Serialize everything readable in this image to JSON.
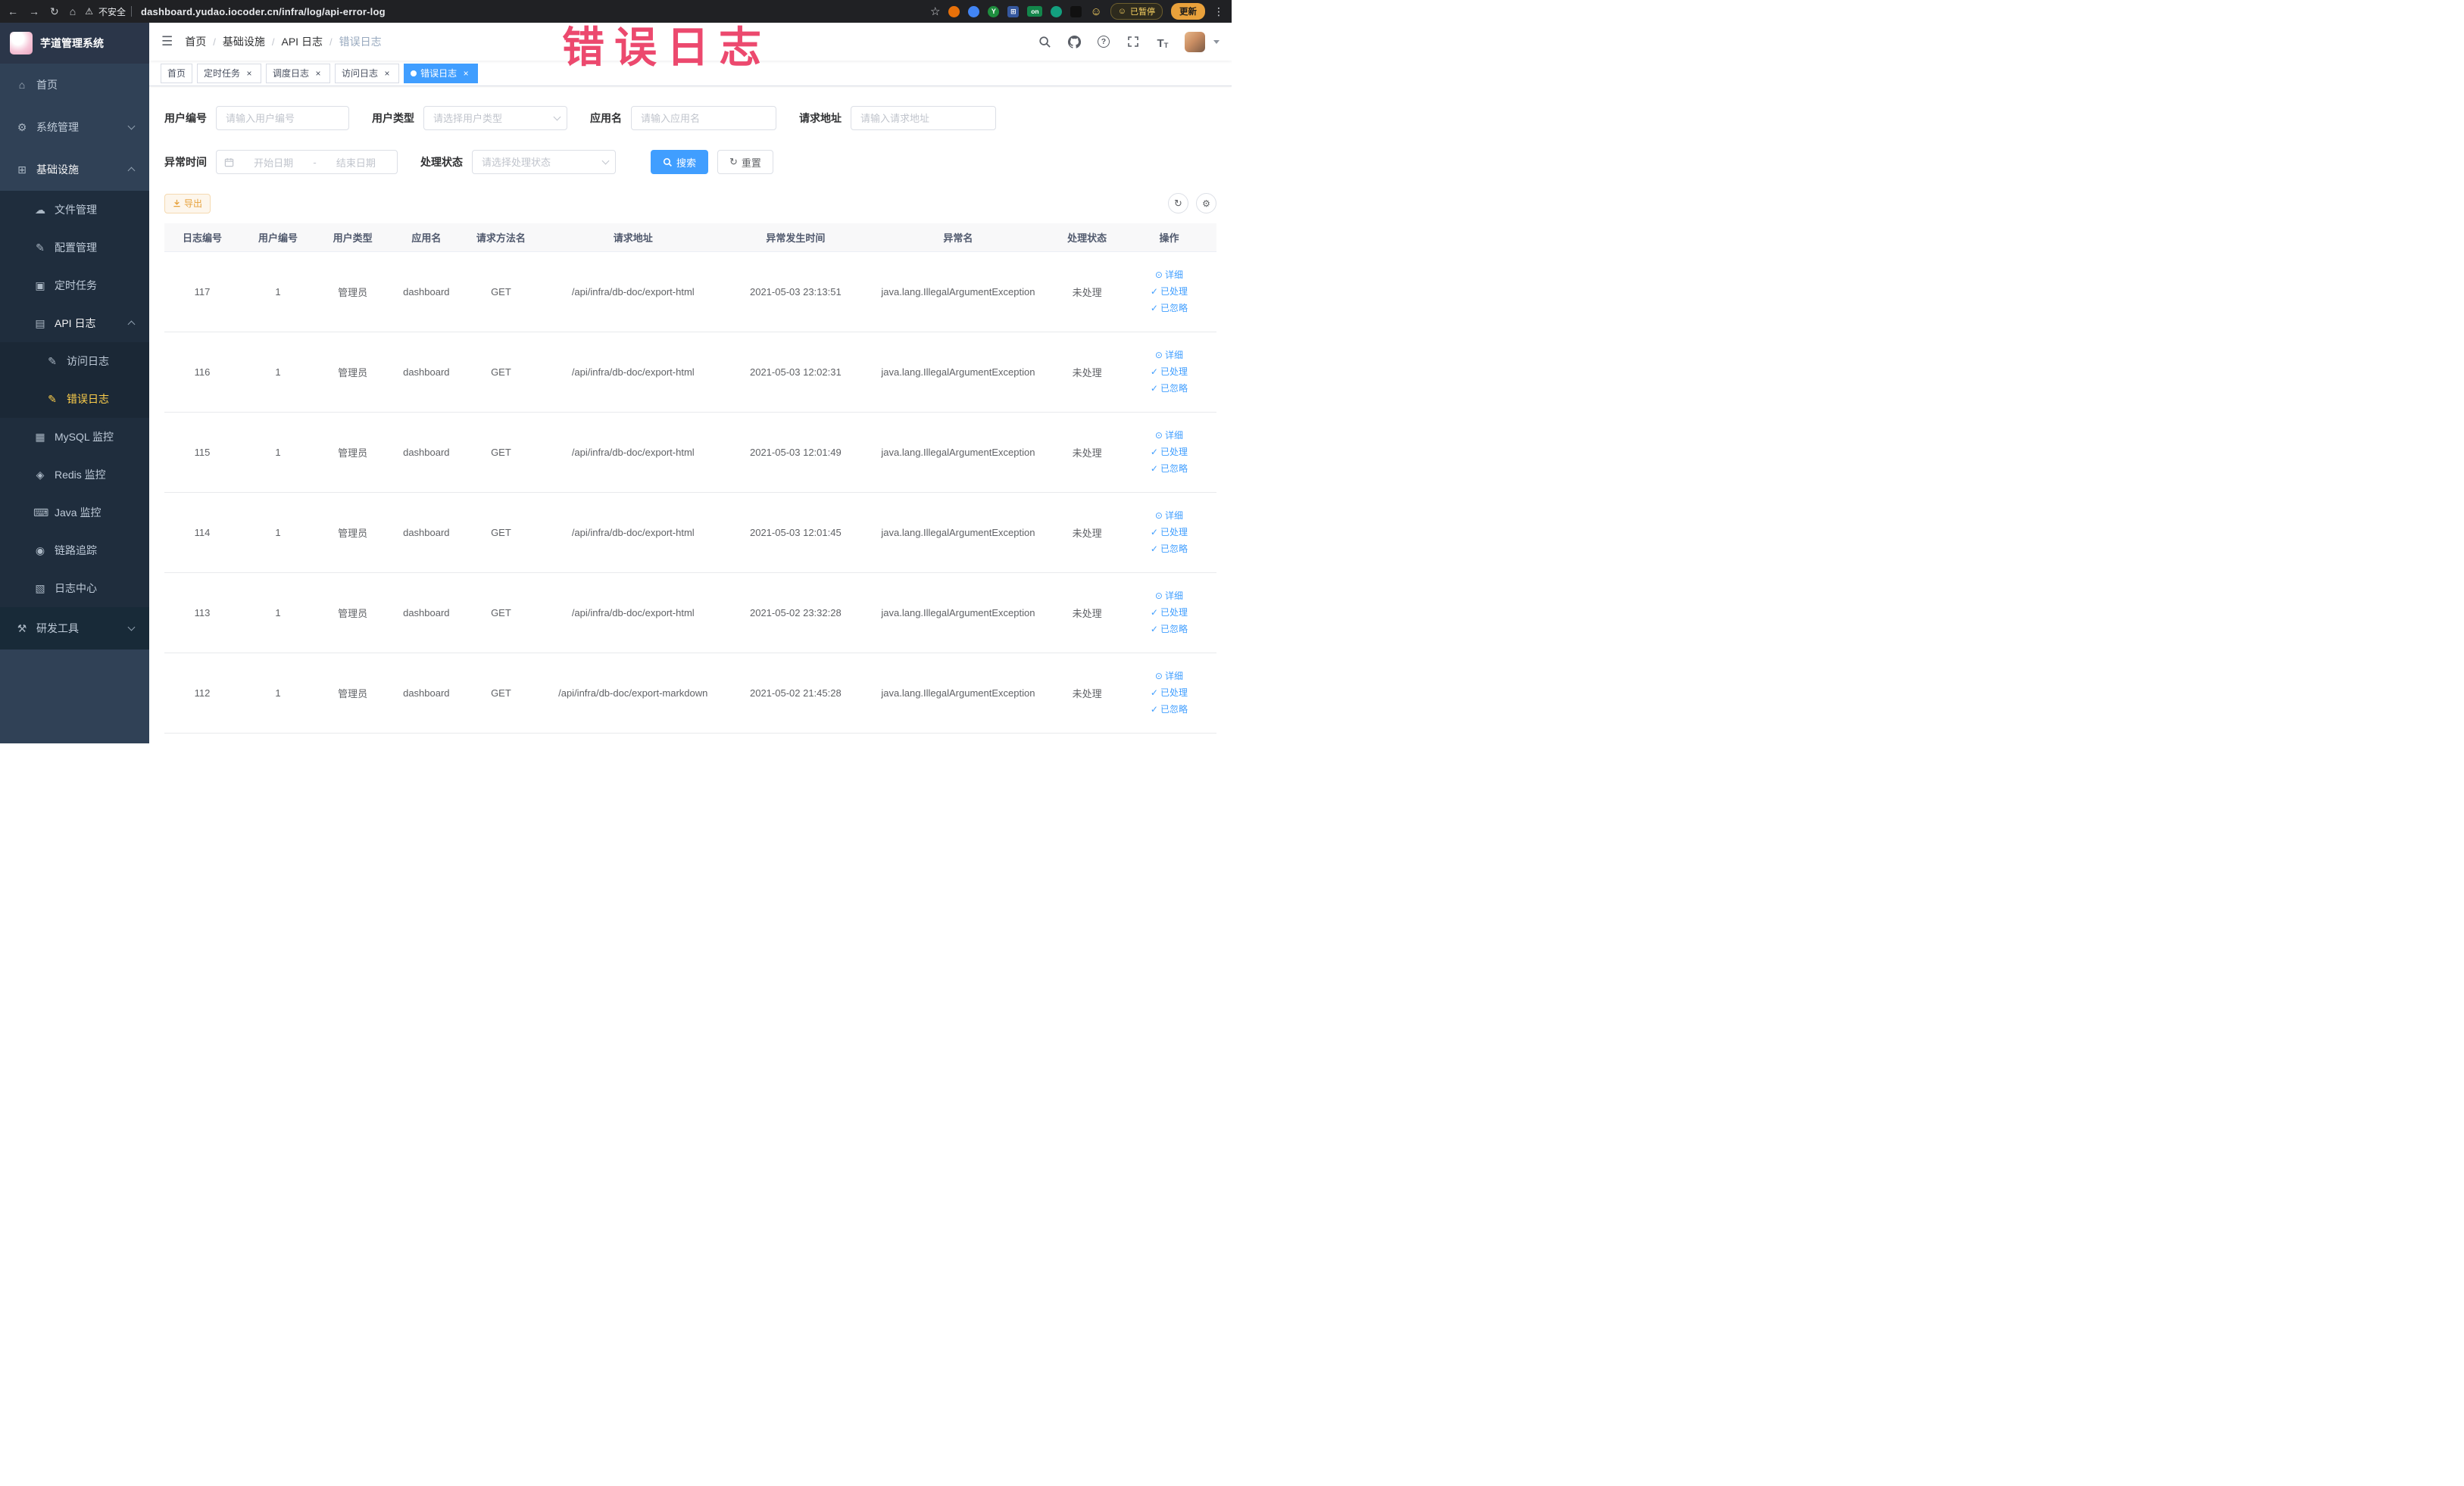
{
  "browser": {
    "security_label": "不安全",
    "url": "dashboard.yudao.iocoder.cn/infra/log/api-error-log",
    "y_badge": "Y",
    "on_badge": "on",
    "paused_badge": "已暂停",
    "update_button": "更新"
  },
  "watermark": "错误日志",
  "colors": {
    "accent": "#409eff",
    "sidebar_bg": "#304156",
    "sidebar_active_text": "#ffd04b",
    "warning": "#e6a23c",
    "watermark_red": "#ec4067"
  },
  "sidebar": {
    "logo_title": "芋道管理系统",
    "menu": [
      {
        "label": "首页",
        "glyph": "⌂"
      },
      {
        "label": "系统管理",
        "glyph": "⚙"
      },
      {
        "label": "基础设施",
        "glyph": "⊞"
      },
      {
        "label": "文件管理",
        "glyph": "☁"
      },
      {
        "label": "配置管理",
        "glyph": "✎"
      },
      {
        "label": "定时任务",
        "glyph": "▣"
      },
      {
        "label": "API 日志",
        "glyph": "▤"
      },
      {
        "label": "访问日志",
        "glyph": "✎"
      },
      {
        "label": "错误日志",
        "glyph": "✎"
      },
      {
        "label": "MySQL 监控",
        "glyph": "▦"
      },
      {
        "label": "Redis 监控",
        "glyph": "◈"
      },
      {
        "label": "Java 监控",
        "glyph": "⌨"
      },
      {
        "label": "链路追踪",
        "glyph": "◉"
      },
      {
        "label": "日志中心",
        "glyph": "▧"
      },
      {
        "label": "研发工具",
        "glyph": "⚒"
      }
    ]
  },
  "header": {
    "breadcrumb": [
      "首页",
      "基础设施",
      "API 日志",
      "错误日志"
    ]
  },
  "tabs": [
    {
      "label": "首页"
    },
    {
      "label": "定时任务"
    },
    {
      "label": "调度日志"
    },
    {
      "label": "访问日志"
    },
    {
      "label": "错误日志"
    }
  ],
  "filters": {
    "user_id_label": "用户编号",
    "user_id_placeholder": "请输入用户编号",
    "user_type_label": "用户类型",
    "user_type_placeholder": "请选择用户类型",
    "app_name_label": "应用名",
    "app_name_placeholder": "请输入应用名",
    "request_url_label": "请求地址",
    "request_url_placeholder": "请输入请求地址",
    "exception_time_label": "异常时间",
    "date_start_placeholder": "开始日期",
    "date_separator": "-",
    "date_end_placeholder": "结束日期",
    "process_status_label": "处理状态",
    "process_status_placeholder": "请选择处理状态",
    "search_button": "搜索",
    "reset_button": "重置"
  },
  "toolbar": {
    "export_button": "导出"
  },
  "table": {
    "columns": [
      "日志编号",
      "用户编号",
      "用户类型",
      "应用名",
      "请求方法名",
      "请求地址",
      "异常发生时间",
      "异常名",
      "处理状态",
      "操作"
    ],
    "actions": {
      "detail": "详细",
      "processed": "已处理",
      "ignored": "已忽略"
    },
    "rows": [
      {
        "id": "117",
        "user_id": "1",
        "user_type": "管理员",
        "app": "dashboard",
        "method": "GET",
        "url": "/api/infra/db-doc/export-html",
        "time": "2021-05-03 23:13:51",
        "exception": "java.lang.IllegalArgumentException",
        "status": "未处理"
      },
      {
        "id": "116",
        "user_id": "1",
        "user_type": "管理员",
        "app": "dashboard",
        "method": "GET",
        "url": "/api/infra/db-doc/export-html",
        "time": "2021-05-03 12:02:31",
        "exception": "java.lang.IllegalArgumentException",
        "status": "未处理"
      },
      {
        "id": "115",
        "user_id": "1",
        "user_type": "管理员",
        "app": "dashboard",
        "method": "GET",
        "url": "/api/infra/db-doc/export-html",
        "time": "2021-05-03 12:01:49",
        "exception": "java.lang.IllegalArgumentException",
        "status": "未处理"
      },
      {
        "id": "114",
        "user_id": "1",
        "user_type": "管理员",
        "app": "dashboard",
        "method": "GET",
        "url": "/api/infra/db-doc/export-html",
        "time": "2021-05-03 12:01:45",
        "exception": "java.lang.IllegalArgumentException",
        "status": "未处理"
      },
      {
        "id": "113",
        "user_id": "1",
        "user_type": "管理员",
        "app": "dashboard",
        "method": "GET",
        "url": "/api/infra/db-doc/export-html",
        "time": "2021-05-02 23:32:28",
        "exception": "java.lang.IllegalArgumentException",
        "status": "未处理"
      },
      {
        "id": "112",
        "user_id": "1",
        "user_type": "管理员",
        "app": "dashboard",
        "method": "GET",
        "url": "/api/infra/db-doc/export-markdown",
        "time": "2021-05-02 21:45:28",
        "exception": "java.lang.IllegalArgumentException",
        "status": "未处理"
      }
    ]
  }
}
